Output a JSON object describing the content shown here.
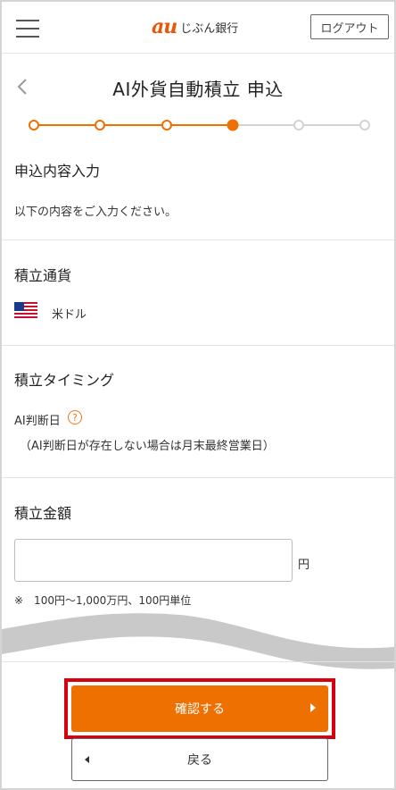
{
  "header": {
    "logo_mark": "au",
    "logo_text": "じぶん銀行",
    "logout_label": "ログアウト",
    "brand_color": "#eb5505"
  },
  "page": {
    "title": "AI外貨自動積立 申込"
  },
  "stepper": {
    "total_steps": 6,
    "current_step": 4,
    "active_color": "#ee7000",
    "inactive_color": "#d3d3d3"
  },
  "intro": {
    "heading": "申込内容入力",
    "text": "以下の内容をご入力ください。"
  },
  "currency": {
    "heading": "積立通貨",
    "value": "米ドル",
    "flag_icon": "us-flag-icon"
  },
  "timing": {
    "heading": "積立タイミング",
    "label": "AI判断日",
    "help_icon": "question-circle-icon",
    "help_glyph": "?",
    "note": "（AI判断日が存在しない場合は月末最終営業日）"
  },
  "amount": {
    "heading": "積立金額",
    "value": "",
    "placeholder": "",
    "unit": "円",
    "note": "※　100円～1,000万円、100円単位"
  },
  "actions": {
    "confirm_label": "確認する",
    "return_label": "戻る",
    "confirm_color": "#ee7000",
    "highlight_color": "#d7000f"
  }
}
